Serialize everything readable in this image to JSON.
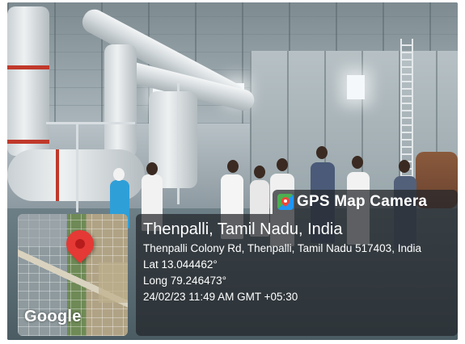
{
  "overlay": {
    "app_name": "GPS Map Camera",
    "location_title": "Thenpalli, Tamil Nadu, India",
    "address": "Thenpalli Colony Rd, Thenpalli, Tamil Nadu 517403, India",
    "latitude": "Lat 13.044462°",
    "longitude": "Long 79.246473°",
    "timestamp": "24/02/23 11:49 AM GMT +05:30",
    "map_logo": "Google",
    "map_pin_color": "#e53935",
    "icons": [
      "gps-map-camera-app-icon",
      "map-pin-icon"
    ]
  }
}
